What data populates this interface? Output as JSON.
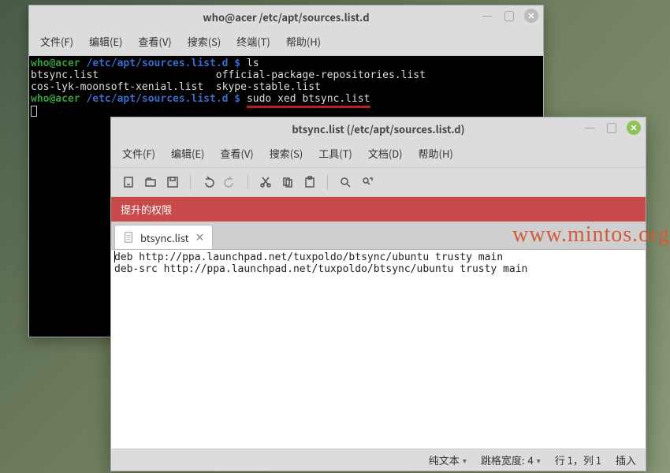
{
  "terminal": {
    "title": "who@acer /etc/apt/sources.list.d",
    "menu": [
      "文件(F)",
      "编辑(E)",
      "查看(V)",
      "搜索(S)",
      "终端(T)",
      "帮助(H)"
    ],
    "prompt_user": "who@acer",
    "prompt_path": "/etc/apt/sources.list.d",
    "prompt_dollar": "$",
    "cmd1": "ls",
    "ls_line1": "btsync.list                   official-package-repositories.list",
    "ls_line2": "cos-lyk-moonsoft-xenial.list  skype-stable.list",
    "cmd2": "sudo xed btsync.list"
  },
  "editor": {
    "title": "btsync.list (/etc/apt/sources.list.d)",
    "menu": [
      "文件(F)",
      "编辑(E)",
      "查看(V)",
      "搜索(S)",
      "工具(T)",
      "文档(D)",
      "帮助(H)"
    ],
    "privilege": "提升的权限",
    "tab_label": "btsync.list",
    "content_line1": "deb http://ppa.launchpad.net/tuxpoldo/btsync/ubuntu trusty main",
    "content_line2": "deb-src http://ppa.launchpad.net/tuxpoldo/btsync/ubuntu trusty main",
    "status": {
      "syntax": "纯文本",
      "tabwidth_label": "跳格宽度:",
      "tabwidth_value": "4",
      "position": "行 1，列 1",
      "insert": "插入"
    }
  },
  "watermark": "www.mintos.org"
}
